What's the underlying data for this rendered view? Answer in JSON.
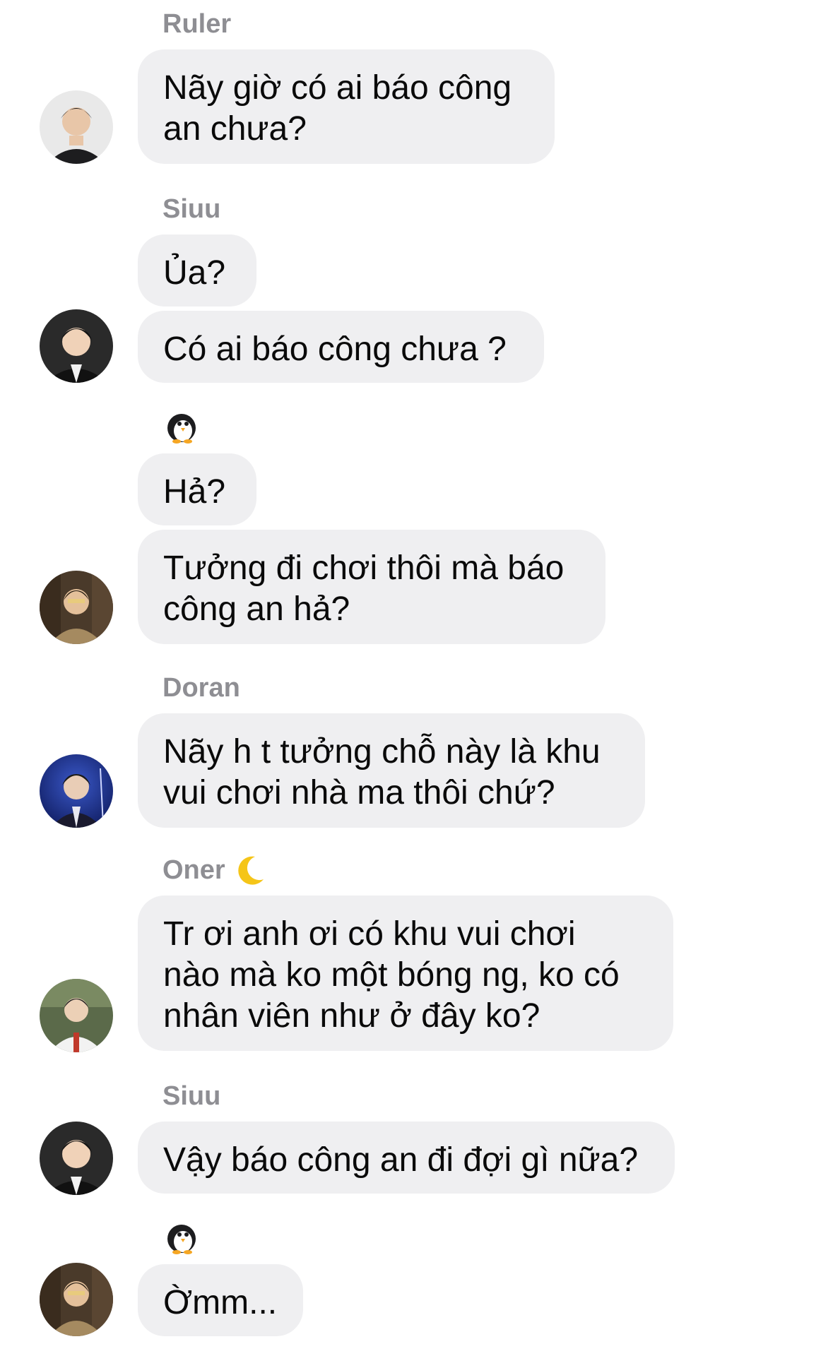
{
  "messages": [
    {
      "sender": "Ruler",
      "text": "Nãy giờ có ai báo công\nan chưa?"
    },
    {
      "sender": "Siuu",
      "text": "Ủa?"
    },
    {
      "text": "Có ai báo công chưa ?"
    },
    {
      "sender_icon": "penguin-icon",
      "text": "Hả?"
    },
    {
      "text": "Tưởng đi chơi thôi mà báo\ncông an hả?"
    },
    {
      "sender": "Doran",
      "text": "Nãy h t tưởng chỗ này là khu\nvui chơi nhà ma thôi chứ?"
    },
    {
      "sender": "Oner",
      "sender_icon": "crescent-moon-icon",
      "text": "Tr ơi anh ơi có khu vui chơi\nnào mà ko một bóng ng, ko có\nnhân viên như ở đây ko?"
    },
    {
      "sender": "Siuu",
      "text": "Vậy báo công an đi đợi gì nữa?"
    },
    {
      "sender_icon": "penguin-icon",
      "text": "Ờmm..."
    }
  ],
  "colors": {
    "bubble_bg": "#efeff1",
    "sender_name": "#8e8e93",
    "text": "#0a0a0a"
  }
}
